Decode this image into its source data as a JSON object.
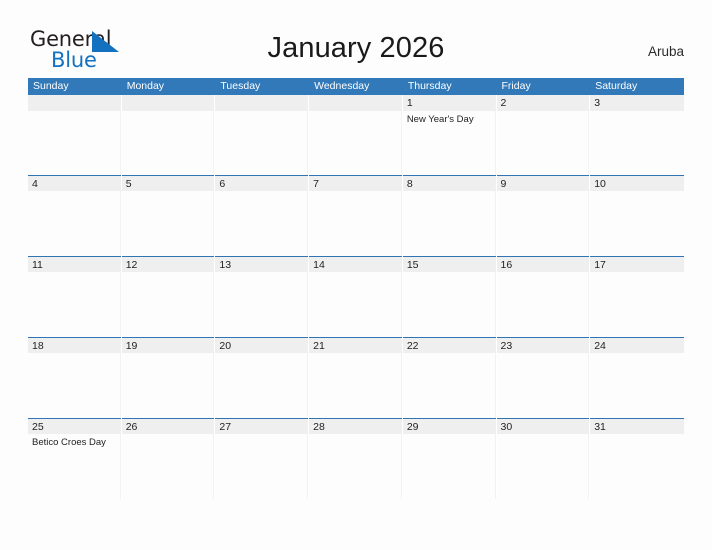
{
  "header": {
    "logo": {
      "text_primary": "General",
      "text_secondary": "Blue",
      "flag_icon": "blue-triangle-flag-icon",
      "primary_color": "#231f20",
      "secondary_color": "#1471c0"
    },
    "title": "January 2026",
    "region": "Aruba"
  },
  "calendar": {
    "accent_color": "#3279b9",
    "date_band_color": "#efefef",
    "weekdays": [
      "Sunday",
      "Monday",
      "Tuesday",
      "Wednesday",
      "Thursday",
      "Friday",
      "Saturday"
    ],
    "weeks": [
      [
        {
          "date": "",
          "events": []
        },
        {
          "date": "",
          "events": []
        },
        {
          "date": "",
          "events": []
        },
        {
          "date": "",
          "events": []
        },
        {
          "date": "1",
          "events": [
            "New Year's Day"
          ]
        },
        {
          "date": "2",
          "events": []
        },
        {
          "date": "3",
          "events": []
        }
      ],
      [
        {
          "date": "4",
          "events": []
        },
        {
          "date": "5",
          "events": []
        },
        {
          "date": "6",
          "events": []
        },
        {
          "date": "7",
          "events": []
        },
        {
          "date": "8",
          "events": []
        },
        {
          "date": "9",
          "events": []
        },
        {
          "date": "10",
          "events": []
        }
      ],
      [
        {
          "date": "11",
          "events": []
        },
        {
          "date": "12",
          "events": []
        },
        {
          "date": "13",
          "events": []
        },
        {
          "date": "14",
          "events": []
        },
        {
          "date": "15",
          "events": []
        },
        {
          "date": "16",
          "events": []
        },
        {
          "date": "17",
          "events": []
        }
      ],
      [
        {
          "date": "18",
          "events": []
        },
        {
          "date": "19",
          "events": []
        },
        {
          "date": "20",
          "events": []
        },
        {
          "date": "21",
          "events": []
        },
        {
          "date": "22",
          "events": []
        },
        {
          "date": "23",
          "events": []
        },
        {
          "date": "24",
          "events": []
        }
      ],
      [
        {
          "date": "25",
          "events": [
            "Betico Croes Day"
          ]
        },
        {
          "date": "26",
          "events": []
        },
        {
          "date": "27",
          "events": []
        },
        {
          "date": "28",
          "events": []
        },
        {
          "date": "29",
          "events": []
        },
        {
          "date": "30",
          "events": []
        },
        {
          "date": "31",
          "events": []
        }
      ]
    ]
  }
}
